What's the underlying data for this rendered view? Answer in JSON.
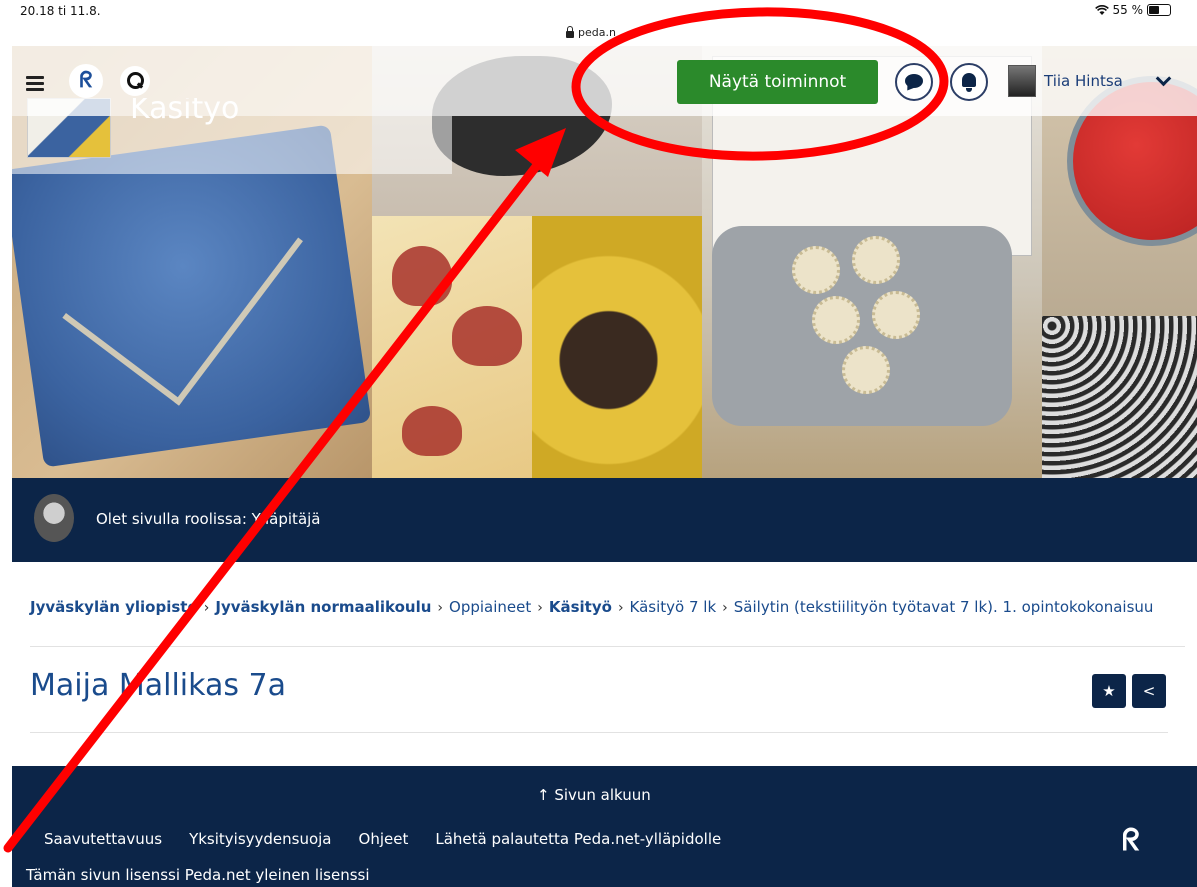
{
  "status_bar": {
    "time": "20.18  ti 11.8.",
    "wifi_icon": "wifi-icon",
    "battery": "55 %",
    "battery_level_percent": 55
  },
  "browser": {
    "url": "peda.n"
  },
  "nav": {
    "menu_icon": "hamburger-icon",
    "logo_glyph": "ᖇ",
    "action_button": "Näytä toiminnot",
    "user_name": "Tiia Hintsa"
  },
  "page_header": {
    "name": "Käsityö"
  },
  "role": {
    "text": "Olet sivulla roolissa: Ylläpitäjä"
  },
  "breadcrumb": [
    "Jyväskylän yliopisto",
    "Jyväskylän normaalikoulu",
    "Oppiaineet",
    "Käsityö",
    "Käsityö 7 lk",
    "Säilytin (tekstiilityön työtavat 7 lk). 1. opintokokonaisuu"
  ],
  "breadcrumb_sep": "›",
  "main": {
    "title": "Maija Mallikas 7a",
    "star_glyph": "★",
    "share_glyph": "<"
  },
  "footer": {
    "to_top": "↑ Sivun alkuun",
    "links": [
      "Saavutettavuus",
      "Yksityisyydensuoja",
      "Ohjeet",
      "Lähetä palautetta Peda.net-ylläpidolle"
    ],
    "logo_glyph": "ᖇ",
    "license": "Tämän sivun lisenssi Peda.net yleinen lisenssi"
  },
  "colors": {
    "navy": "#0c2548",
    "green": "#2b8a2b",
    "link_blue": "#1a4b8c",
    "annotation_red": "#ff0000"
  }
}
